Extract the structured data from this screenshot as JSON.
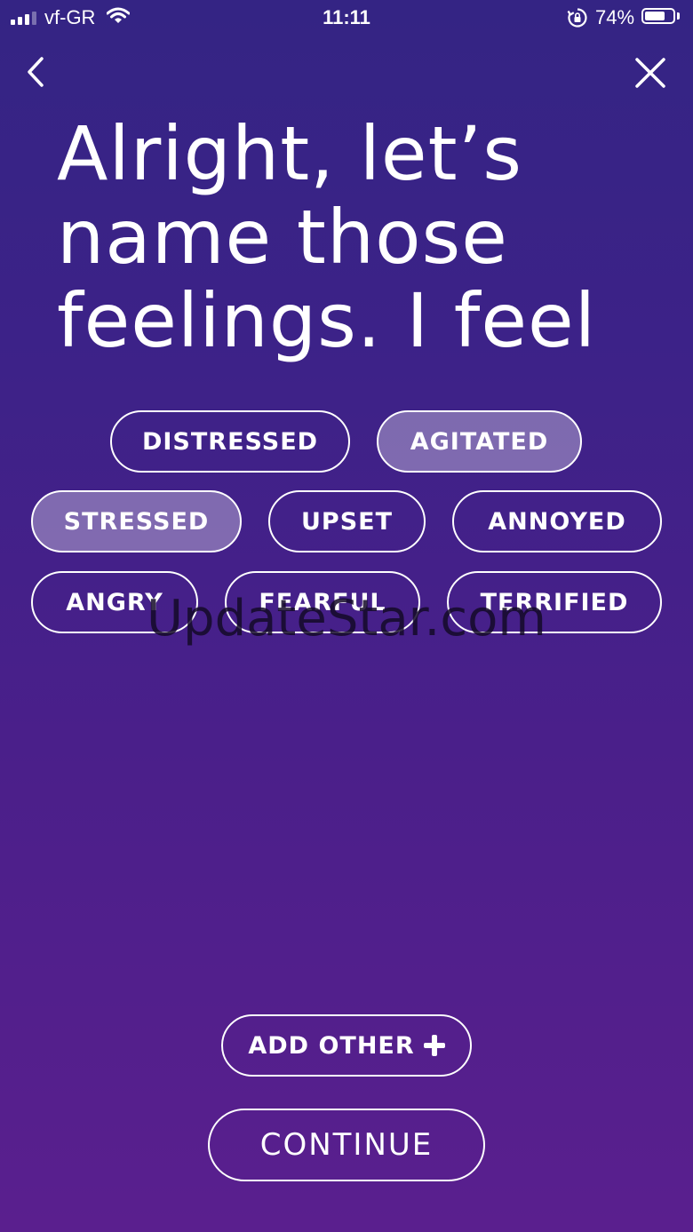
{
  "status_bar": {
    "carrier": "vf-GR",
    "time": "11:11",
    "battery_percent": "74%",
    "battery_level": 0.74,
    "icons": [
      "signal-icon",
      "wifi-icon",
      "rotation-lock-icon",
      "battery-icon"
    ]
  },
  "nav": {
    "back_icon": "chevron-left-icon",
    "close_icon": "close-icon"
  },
  "heading": "Alright, let’s name those feelings. I feel",
  "feelings": [
    {
      "label": "DISTRESSED",
      "selected": false
    },
    {
      "label": "AGITATED",
      "selected": true
    },
    {
      "label": "STRESSED",
      "selected": true
    },
    {
      "label": "UPSET",
      "selected": false
    },
    {
      "label": "ANNOYED",
      "selected": false
    },
    {
      "label": "ANGRY",
      "selected": false
    },
    {
      "label": "FEARFUL",
      "selected": false
    },
    {
      "label": "TERRIFIED",
      "selected": false
    }
  ],
  "watermark": "UpdateStar.com",
  "actions": {
    "add_other": "ADD OTHER",
    "add_other_icon": "plus-icon",
    "continue": "CONTINUE"
  },
  "colors": {
    "background_top": "#342484",
    "background_bottom": "#5a1f8e",
    "foreground": "#ffffff"
  }
}
